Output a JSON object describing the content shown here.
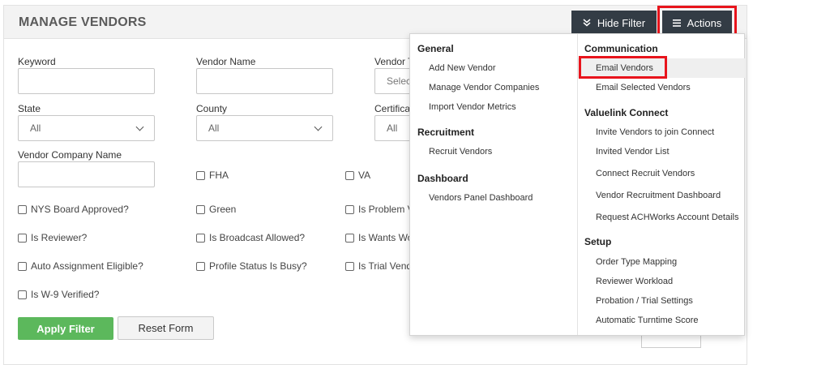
{
  "page": {
    "title": "MANAGE VENDORS"
  },
  "toolbar": {
    "hide_filter_label": "Hide Filter",
    "actions_label": "Actions",
    "hide_filter_icon": "double-chevron-down-icon",
    "actions_icon": "hamburger-menu-icon"
  },
  "filter": {
    "keyword_label": "Keyword",
    "vendor_name_label": "Vendor Name",
    "vendor_type_label": "Vendor T",
    "vendor_type_placeholder": "Selec",
    "state_label": "State",
    "state_value": "All",
    "county_label": "County",
    "county_value": "All",
    "certification_label": "Certifica",
    "certification_value": "All",
    "vendor_company_label": "Vendor Company Name",
    "checkboxes": {
      "fha": "FHA",
      "va": "VA",
      "nys": "NYS Board Approved?",
      "green": "Green",
      "is_problem": "Is Problem V",
      "is_reviewer": "Is Reviewer?",
      "broadcast": "Is Broadcast Allowed?",
      "wants_work": "Is Wants Wo",
      "auto_assign": "Auto Assignment Eligible?",
      "profile_busy": "Profile Status Is Busy?",
      "trial_vendor": "Is Trial Vend",
      "w9": "Is W-9 Verified?"
    },
    "apply_label": "Apply Filter",
    "reset_label": "Reset Form"
  },
  "actions_menu": {
    "left": [
      {
        "heading": "General",
        "items": [
          "Add New Vendor",
          "Manage Vendor Companies",
          "Import Vendor Metrics"
        ]
      },
      {
        "heading": "Recruitment",
        "items": [
          "Recruit Vendors"
        ]
      },
      {
        "heading": "Dashboard",
        "items": [
          "Vendors Panel Dashboard"
        ]
      }
    ],
    "right": [
      {
        "heading": "Communication",
        "items": [
          "Email Vendors",
          "Email Selected Vendors"
        ]
      },
      {
        "heading": "Valuelink Connect",
        "items": [
          "Invite Vendors to join Connect",
          "Invited Vendor List",
          "Connect Recruit Vendors",
          "Vendor Recruitment Dashboard",
          "Request ACHWorks Account Details"
        ]
      },
      {
        "heading": "Setup",
        "items": [
          "Order Type Mapping",
          "Reviewer Workload",
          "Probation / Trial Settings",
          "Automatic Turntime Score"
        ]
      }
    ]
  },
  "colors": {
    "highlight": "#e8141c",
    "dark_button": "#333c45",
    "apply_green": "#5cb85c"
  }
}
